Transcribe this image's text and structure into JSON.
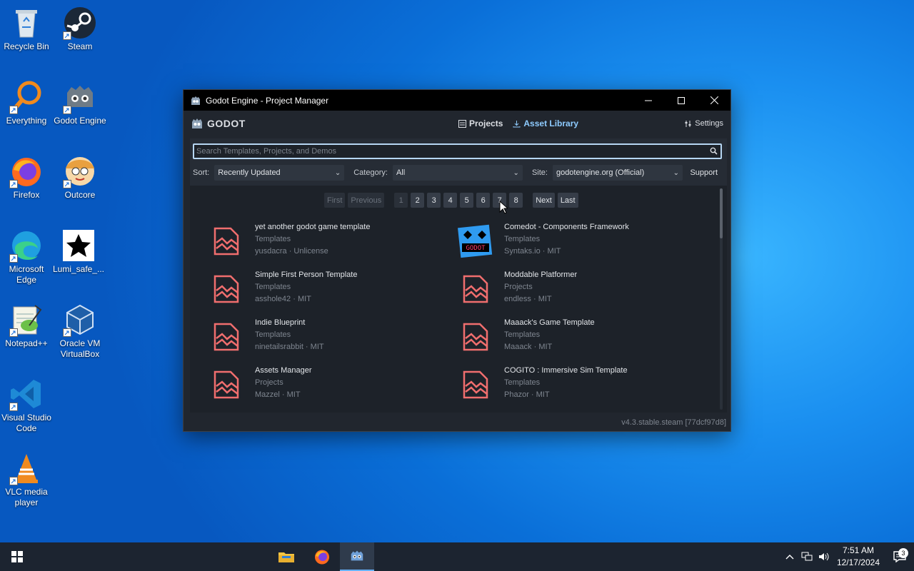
{
  "desktop": {
    "icons": [
      {
        "label": "Recycle Bin"
      },
      {
        "label": "Steam"
      },
      {
        "label": "Everything"
      },
      {
        "label": "Godot Engine"
      },
      {
        "label": "Firefox"
      },
      {
        "label": "Outcore"
      },
      {
        "label": "Microsoft Edge"
      },
      {
        "label": "Lumi_safe_..."
      },
      {
        "label": "Notepad++"
      },
      {
        "label": "Oracle VM VirtualBox"
      },
      {
        "label": "Visual Studio Code"
      },
      {
        "label": "VLC media player"
      }
    ]
  },
  "window": {
    "title": "Godot Engine - Project Manager",
    "brand": "GODOT",
    "tabs": [
      {
        "label": "Projects"
      },
      {
        "label": "Asset Library"
      }
    ],
    "settings_label": "Settings",
    "search": {
      "placeholder": "Search Templates, Projects, and Demos"
    },
    "filters": {
      "sort_label": "Sort:",
      "sort_value": "Recently Updated",
      "category_label": "Category:",
      "category_value": "All",
      "site_label": "Site:",
      "site_value": "godotengine.org (Official)",
      "support_label": "Support"
    },
    "pager": {
      "first": "First",
      "previous": "Previous",
      "pages": [
        "1",
        "2",
        "3",
        "4",
        "5",
        "6",
        "7",
        "8"
      ],
      "current": "1",
      "next": "Next",
      "last": "Last"
    },
    "assets": [
      {
        "name": "yet another godot game template",
        "category": "Templates",
        "author": "yusdacra",
        "license": "Unlicense"
      },
      {
        "name": "Comedot - Components Framework",
        "category": "Templates",
        "author": "Syntaks.io",
        "license": "MIT"
      },
      {
        "name": "Simple First Person Template",
        "category": "Templates",
        "author": "asshole42",
        "license": "MIT"
      },
      {
        "name": "Moddable Platformer",
        "category": "Projects",
        "author": "endless",
        "license": "MIT"
      },
      {
        "name": "Indie Blueprint",
        "category": "Templates",
        "author": "ninetailsrabbit",
        "license": "MIT"
      },
      {
        "name": "Maaack's Game Template",
        "category": "Templates",
        "author": "Maaack",
        "license": "MIT"
      },
      {
        "name": "Assets Manager",
        "category": "Projects",
        "author": "Mazzel",
        "license": "MIT"
      },
      {
        "name": "COGITO : Immersive Sim Template",
        "category": "Templates",
        "author": "Phazor",
        "license": "MIT"
      }
    ],
    "meta_sep": " · ",
    "version": "v4.3.stable.steam [77dcf97d8]"
  },
  "taskbar": {
    "time": "7:51 AM",
    "date": "12/17/2024",
    "notifications": "3"
  },
  "colors": {
    "accent": "#8ecbff",
    "panel": "#262c35",
    "titlebar": "#000000"
  }
}
